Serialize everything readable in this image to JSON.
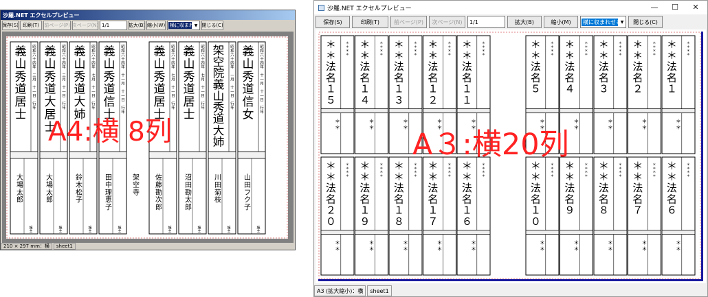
{
  "win_a4": {
    "title": "沙羅.NET エクセルプレビュー",
    "toolbar": {
      "save": "保存(S)",
      "print": "印刷(T)",
      "prev": "前ページ(P)",
      "next": "次ページ(N)",
      "page_value": "1/1",
      "zoom_in": "拡大(B)",
      "zoom_out": "縮小(W)",
      "fit_select": "横に収まれせる",
      "close": "閉じる(C)"
    },
    "status": {
      "size": "210 × 297 mm：横",
      "sheet": "sheet1"
    },
    "overlay": "A4:横 8列",
    "tablets": [
      {
        "main": "義山秀道居士",
        "date": "昭和六十四年 三月 十一日 行年",
        "family": "大場太郎",
        "foot": "施主"
      },
      {
        "main": "義山秀道大居士",
        "date": "昭和六十四年 三月 十一日 行年",
        "family": "大場太郎",
        "foot": "施主"
      },
      {
        "main": "義山秀道大姉",
        "date": "昭和六十四年 七月 十一日 行年",
        "family": "鈴木松子",
        "foot": "施主"
      },
      {
        "main": "義山秀道信士",
        "date": "昭和六十四年 十一月 十一日 行年",
        "family": "田中理恵子",
        "foot": "施主"
      },
      {
        "main": "義山秀道居士",
        "date": "昭和六十四年 七月 十一日 行年",
        "family": "佐藤勘次郎",
        "foot": "施主"
      },
      {
        "main": "義山秀道居士",
        "date": "昭和六十四年 七月 十一日 行年",
        "family": "沼田勘太郎",
        "foot": "施主"
      },
      {
        "main": "架空院義山秀道大姉",
        "date": "昭和六十四年 一月 十一日 行年",
        "family": "川田菊枝",
        "foot": "施主"
      },
      {
        "main": "義山秀道信女",
        "date": "昭和六十四年 十一月 十一日 行年",
        "family": "山田フク子",
        "foot": "施主"
      }
    ],
    "temple": "架空寺"
  },
  "win_a3": {
    "title": "沙羅.NET エクセルプレビュー",
    "toolbar": {
      "save": "保存(S)",
      "print": "印刷(T)",
      "prev": "前ページ(P)",
      "next": "次ページ(N)",
      "page_value": "1/1",
      "zoom_in": "拡大(B)",
      "zoom_out": "縮小(M)",
      "fit_select": "横に収まれせる",
      "close": "閉じる(C)"
    },
    "status": {
      "size": "A3 (拡大縮小)：横",
      "sheet": "sheet1"
    },
    "overlay": "A３:横20列",
    "top_row": [
      "＊＊法名１５",
      "＊＊法名１４",
      "＊＊法名１３",
      "＊＊法名１２",
      "＊＊法名１１",
      "＊＊法名５",
      "＊＊法名４",
      "＊＊法名３",
      "＊＊法名２",
      "＊＊法名１"
    ],
    "bottom_row": [
      "＊＊法名２０",
      "＊＊法名１９",
      "＊＊法名１８",
      "＊＊法名１７",
      "＊＊法名１６",
      "＊＊法名１０",
      "＊＊法名９",
      "＊＊法名８",
      "＊＊法名７",
      "＊＊法名６"
    ]
  }
}
